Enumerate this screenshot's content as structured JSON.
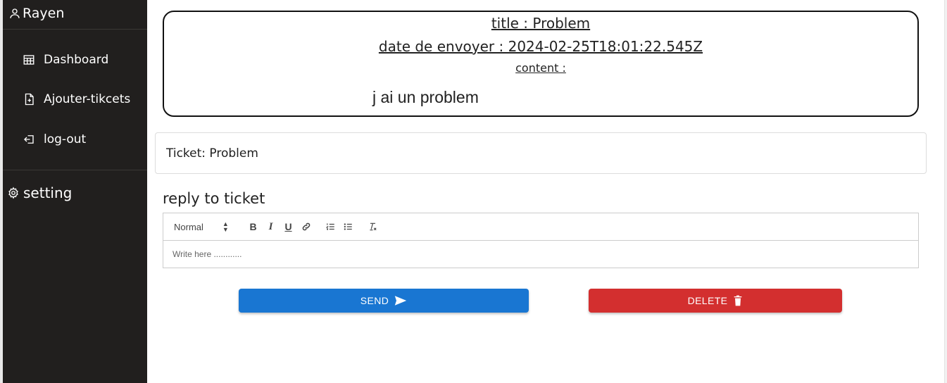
{
  "user": {
    "name": "Rayen",
    "icon": "user-icon"
  },
  "nav": [
    {
      "label": "Dashboard",
      "icon": "table-icon"
    },
    {
      "label": "Ajouter-tikcets",
      "icon": "file-plus-icon"
    },
    {
      "label": "log-out",
      "icon": "logout-icon"
    }
  ],
  "setting": {
    "label": "setting",
    "icon": "gear-icon"
  },
  "ticket": {
    "title_line": "title : Problem",
    "date_line": "date de envoyer : 2024-02-25T18:01:22.545Z",
    "content_label": "content :",
    "content": "j ai un problem"
  },
  "summary": {
    "text": "Ticket: Problem"
  },
  "reply": {
    "heading": "reply to ticket",
    "format_select": "Normal",
    "placeholder": "Write here ............"
  },
  "buttons": {
    "send": "SEND",
    "delete": "DELETE"
  },
  "colors": {
    "sidebar": "#211f1e",
    "send": "#1976d2",
    "delete": "#d32f2f"
  }
}
